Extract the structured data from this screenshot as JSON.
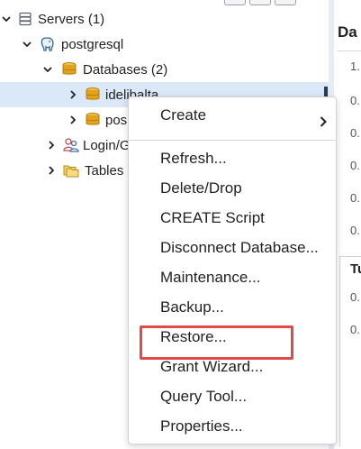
{
  "tree": {
    "servers": {
      "label": "Servers (1)"
    },
    "server": {
      "label": "postgresql"
    },
    "databases": {
      "label": "Databases (2)"
    },
    "db1": {
      "label": "idelibalta"
    },
    "db2": {
      "label": "pos"
    },
    "login": {
      "label": "Login/G"
    },
    "tables": {
      "label": "Tables"
    }
  },
  "right_panel": {
    "title": "Da",
    "rows": [
      "1.",
      "0.",
      "0.",
      "0.",
      "0.",
      "0.",
      "0.",
      "0."
    ],
    "title2": "Tu"
  },
  "context_menu": {
    "items": [
      {
        "label": "Create",
        "submenu": true
      },
      {
        "label": "Refresh..."
      },
      {
        "label": "Delete/Drop"
      },
      {
        "label": "CREATE Script"
      },
      {
        "label": "Disconnect Database..."
      },
      {
        "label": "Maintenance..."
      },
      {
        "label": "Backup..."
      },
      {
        "label": "Restore...",
        "highlighted": true
      },
      {
        "label": "Grant Wizard..."
      },
      {
        "label": "Query Tool..."
      },
      {
        "label": "Properties..."
      }
    ]
  },
  "colors": {
    "selection": "#dbe8f7",
    "highlight_border": "#e04a4a",
    "database_icon": "#e0a31a",
    "server_icon": "#336791"
  },
  "icons": {
    "servers": "server-group-icon",
    "server": "postgres-elephant-icon",
    "databases": "database-stack-icon",
    "login": "login-group-roles-icon",
    "tables": "tablespaces-folder-icon"
  }
}
